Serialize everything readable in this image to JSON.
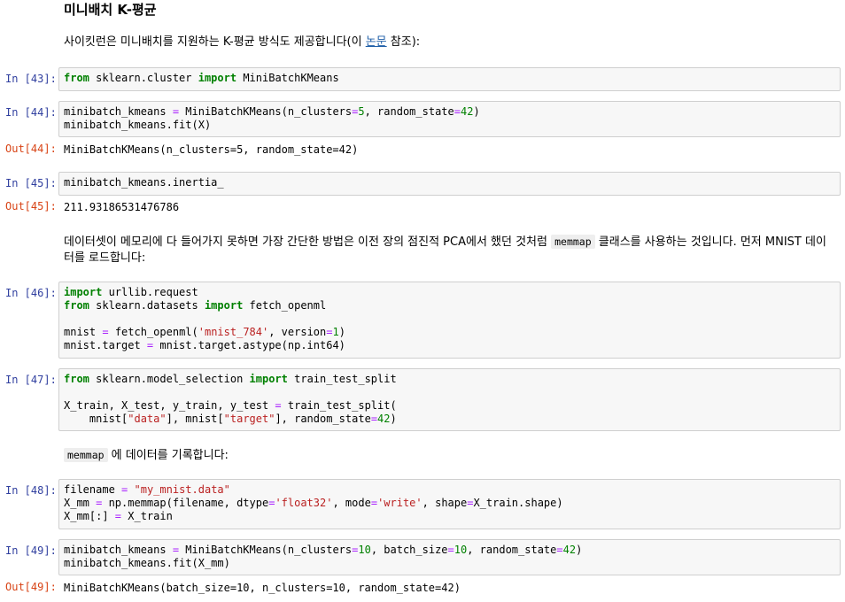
{
  "heading": "미니배치 K-평균",
  "intro": {
    "before": "사이킷런은 미니배치를 지원하는 K-평균 방식도 제공합니다(이 ",
    "link": "논문",
    "after": " 참조):"
  },
  "cells": {
    "c43": {
      "prompt": "In [43]:"
    },
    "c44": {
      "prompt": "In [44]:",
      "out_prompt": "Out[44]:",
      "output": "MiniBatchKMeans(n_clusters=5, random_state=42)"
    },
    "c45": {
      "prompt": "In [45]:",
      "out_prompt": "Out[45]:",
      "output": "211.93186531476786"
    },
    "c46": {
      "prompt": "In [46]:"
    },
    "c47": {
      "prompt": "In [47]:"
    },
    "c48": {
      "prompt": "In [48]:"
    },
    "c49": {
      "prompt": "In [49]:",
      "out_prompt": "Out[49]:",
      "output": "MiniBatchKMeans(batch_size=10, n_clusters=10, random_state=42)"
    }
  },
  "md2": {
    "before": "데이터셋이 메모리에 다 들어가지 못하면 가장 간단한 방법은 이전 장의 점진적 PCA에서 했던 것처럼 ",
    "code": "memmap",
    "after": " 클래스를 사용하는 것입니다. 먼저 MNIST 데이터를 로드합니다:"
  },
  "md3": {
    "code": "memmap",
    "after": " 에 데이터를 기록합니다:"
  }
}
